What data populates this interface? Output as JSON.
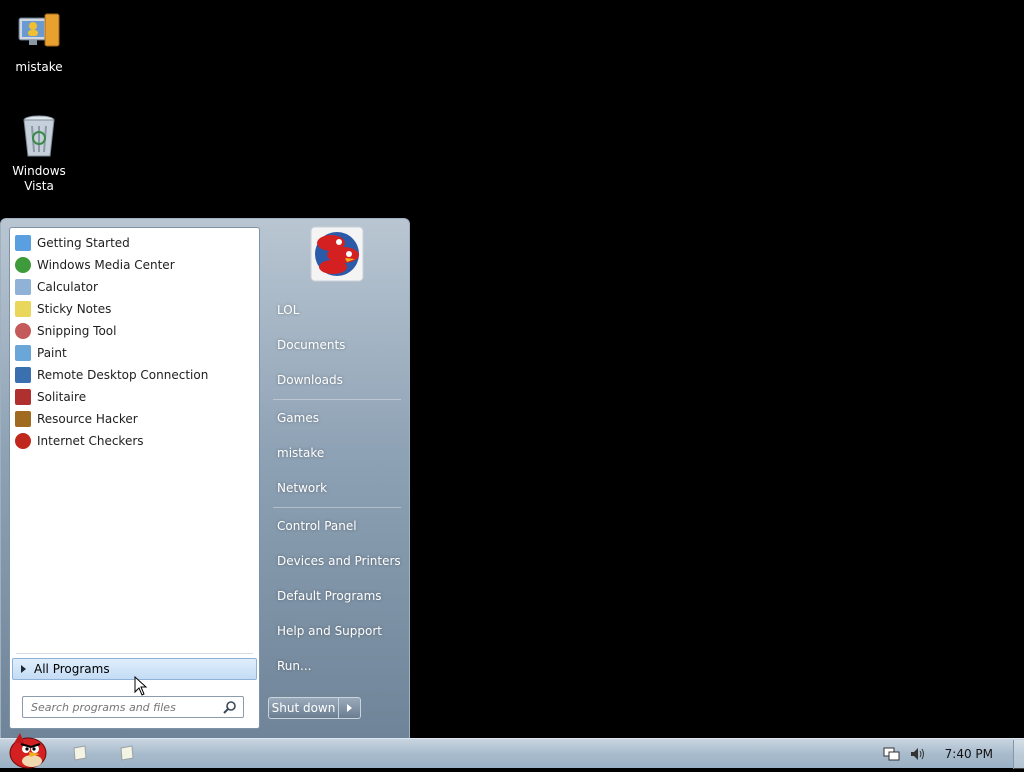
{
  "desktop": {
    "icons": [
      {
        "label": "mistake",
        "icon": "computer-user-icon"
      },
      {
        "label": "Windows Vista",
        "icon": "recycle-bin-icon"
      }
    ]
  },
  "start_menu": {
    "programs": [
      {
        "label": "Getting Started",
        "icon": "getting-started-icon",
        "color": "#5aa0e0"
      },
      {
        "label": "Windows Media Center",
        "icon": "media-center-icon",
        "color": "#3e9a3a"
      },
      {
        "label": "Calculator",
        "icon": "calculator-icon",
        "color": "#8fb2d6"
      },
      {
        "label": "Sticky Notes",
        "icon": "sticky-notes-icon",
        "color": "#e8d75a"
      },
      {
        "label": "Snipping Tool",
        "icon": "snipping-tool-icon",
        "color": "#c45a5a"
      },
      {
        "label": "Paint",
        "icon": "paint-icon",
        "color": "#6aa6d8"
      },
      {
        "label": "Remote Desktop Connection",
        "icon": "remote-desktop-icon",
        "color": "#3a6fb0"
      },
      {
        "label": "Solitaire",
        "icon": "solitaire-icon",
        "color": "#b03030"
      },
      {
        "label": "Resource Hacker",
        "icon": "resource-hacker-icon",
        "color": "#a06a20"
      },
      {
        "label": "Internet Checkers",
        "icon": "internet-checkers-icon",
        "color": "#c0281e"
      }
    ],
    "all_programs_label": "All Programs",
    "search_placeholder": "Search programs and files",
    "right_items": [
      {
        "label": "LOL"
      },
      {
        "label": "Documents"
      },
      {
        "label": "Downloads"
      },
      {
        "label": "Games"
      },
      {
        "label": "mistake"
      },
      {
        "label": "Network"
      },
      {
        "label": "Control Panel"
      },
      {
        "label": "Devices and Printers"
      },
      {
        "label": "Default Programs"
      },
      {
        "label": "Help and Support"
      },
      {
        "label": "Run..."
      }
    ],
    "shutdown_label": "Shut down"
  },
  "taskbar": {
    "clock": "7:40 PM",
    "pinned": [
      "sticky-notes-icon",
      "sticky-notes-icon"
    ],
    "tray_icons": [
      "network-icon",
      "volume-icon"
    ]
  },
  "colors": {
    "desktop_bg": "#000000",
    "start_menu_accent": "#8ea2b5",
    "taskbar": "#a9bccd"
  }
}
